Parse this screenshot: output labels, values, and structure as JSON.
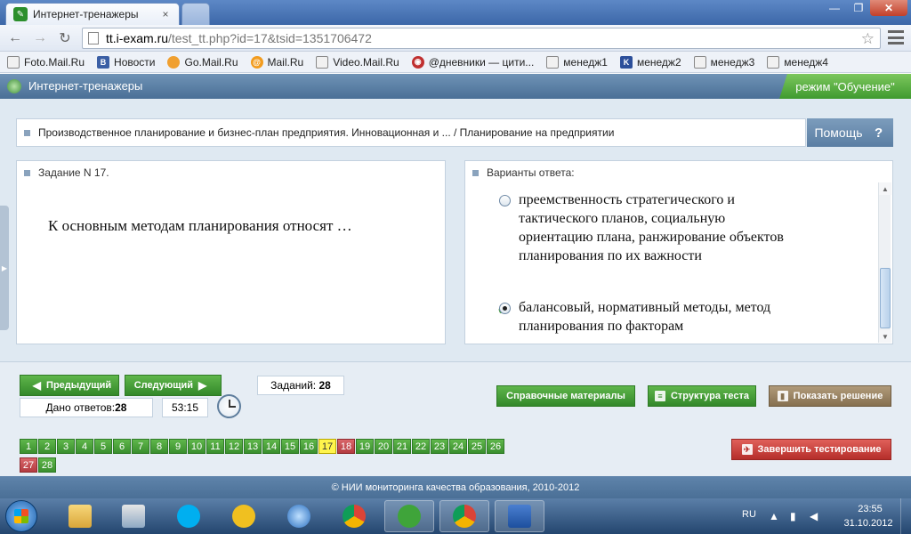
{
  "browser": {
    "tab_title": "Интернет-тренажеры",
    "tab_close": "×",
    "window_min": "—",
    "window_max": "❐",
    "window_close": "✕",
    "url_host": "tt.i-exam.ru",
    "url_path": "/test_tt.php?id=17&tsid=1351706472",
    "bookmarks": [
      "Foto.Mail.Ru",
      "Новости",
      "Go.Mail.Ru",
      "Mail.Ru",
      "Video.Mail.Ru",
      "@дневники — цити...",
      "менедж1",
      "менедж2",
      "менедж3",
      "менедж4"
    ]
  },
  "site": {
    "name": "Интернет-тренажеры",
    "mode": "режим \"Обучение\"",
    "breadcrumb": "Производственное планирование и бизнес-план предприятия. Инновационная и ... / Планирование на предприятии",
    "help_label": "Помощь",
    "help_icon": "?"
  },
  "question": {
    "header": "Задание N 17.",
    "text": "К основным методам планирования относят …"
  },
  "answers": {
    "header": "Варианты ответа:",
    "items": [
      {
        "text": "преемственность стратегического и тактического планов, социальную ориентацию плана, ранжирование объектов планирования по их важности",
        "selected": false
      },
      {
        "text": "балансовый, нормативный методы, метод планирования по факторам",
        "selected": true
      }
    ]
  },
  "controls": {
    "prev_label": "Предыдущий",
    "next_label": "Следующий",
    "answered_label": "Дано ответов:",
    "answered_value": "28",
    "timer": "53:15",
    "tasks_label": "Заданий:",
    "tasks_value": "28",
    "ref_label": "Справочные материалы",
    "structure_label": "Структура теста",
    "solution_label": "Показать решение",
    "finish_label": "Завершить тестирование"
  },
  "task_numbers": [
    {
      "n": "1",
      "state": "answered"
    },
    {
      "n": "2",
      "state": "answered"
    },
    {
      "n": "3",
      "state": "answered"
    },
    {
      "n": "4",
      "state": "answered"
    },
    {
      "n": "5",
      "state": "answered"
    },
    {
      "n": "6",
      "state": "answered"
    },
    {
      "n": "7",
      "state": "answered"
    },
    {
      "n": "8",
      "state": "answered"
    },
    {
      "n": "9",
      "state": "answered"
    },
    {
      "n": "10",
      "state": "answered"
    },
    {
      "n": "11",
      "state": "answered"
    },
    {
      "n": "12",
      "state": "answered"
    },
    {
      "n": "13",
      "state": "answered"
    },
    {
      "n": "14",
      "state": "answered"
    },
    {
      "n": "15",
      "state": "answered"
    },
    {
      "n": "16",
      "state": "answered"
    },
    {
      "n": "17",
      "state": "current"
    },
    {
      "n": "18",
      "state": "wrong"
    },
    {
      "n": "19",
      "state": "answered"
    },
    {
      "n": "20",
      "state": "answered"
    },
    {
      "n": "21",
      "state": "answered"
    },
    {
      "n": "22",
      "state": "answered"
    },
    {
      "n": "23",
      "state": "answered"
    },
    {
      "n": "24",
      "state": "answered"
    },
    {
      "n": "25",
      "state": "answered"
    },
    {
      "n": "26",
      "state": "answered"
    },
    {
      "n": "27",
      "state": "wrong"
    },
    {
      "n": "28",
      "state": "answered"
    }
  ],
  "footer": "© НИИ мониторинга качества образования, 2010-2012",
  "taskbar": {
    "lang": "RU",
    "time": "23:55",
    "date": "31.10.2012"
  },
  "colors": {
    "accent_green": "#3f9a2f",
    "header_blue": "#4a6f96",
    "current_task": "#fff44c",
    "wrong_task": "#b33b40"
  }
}
